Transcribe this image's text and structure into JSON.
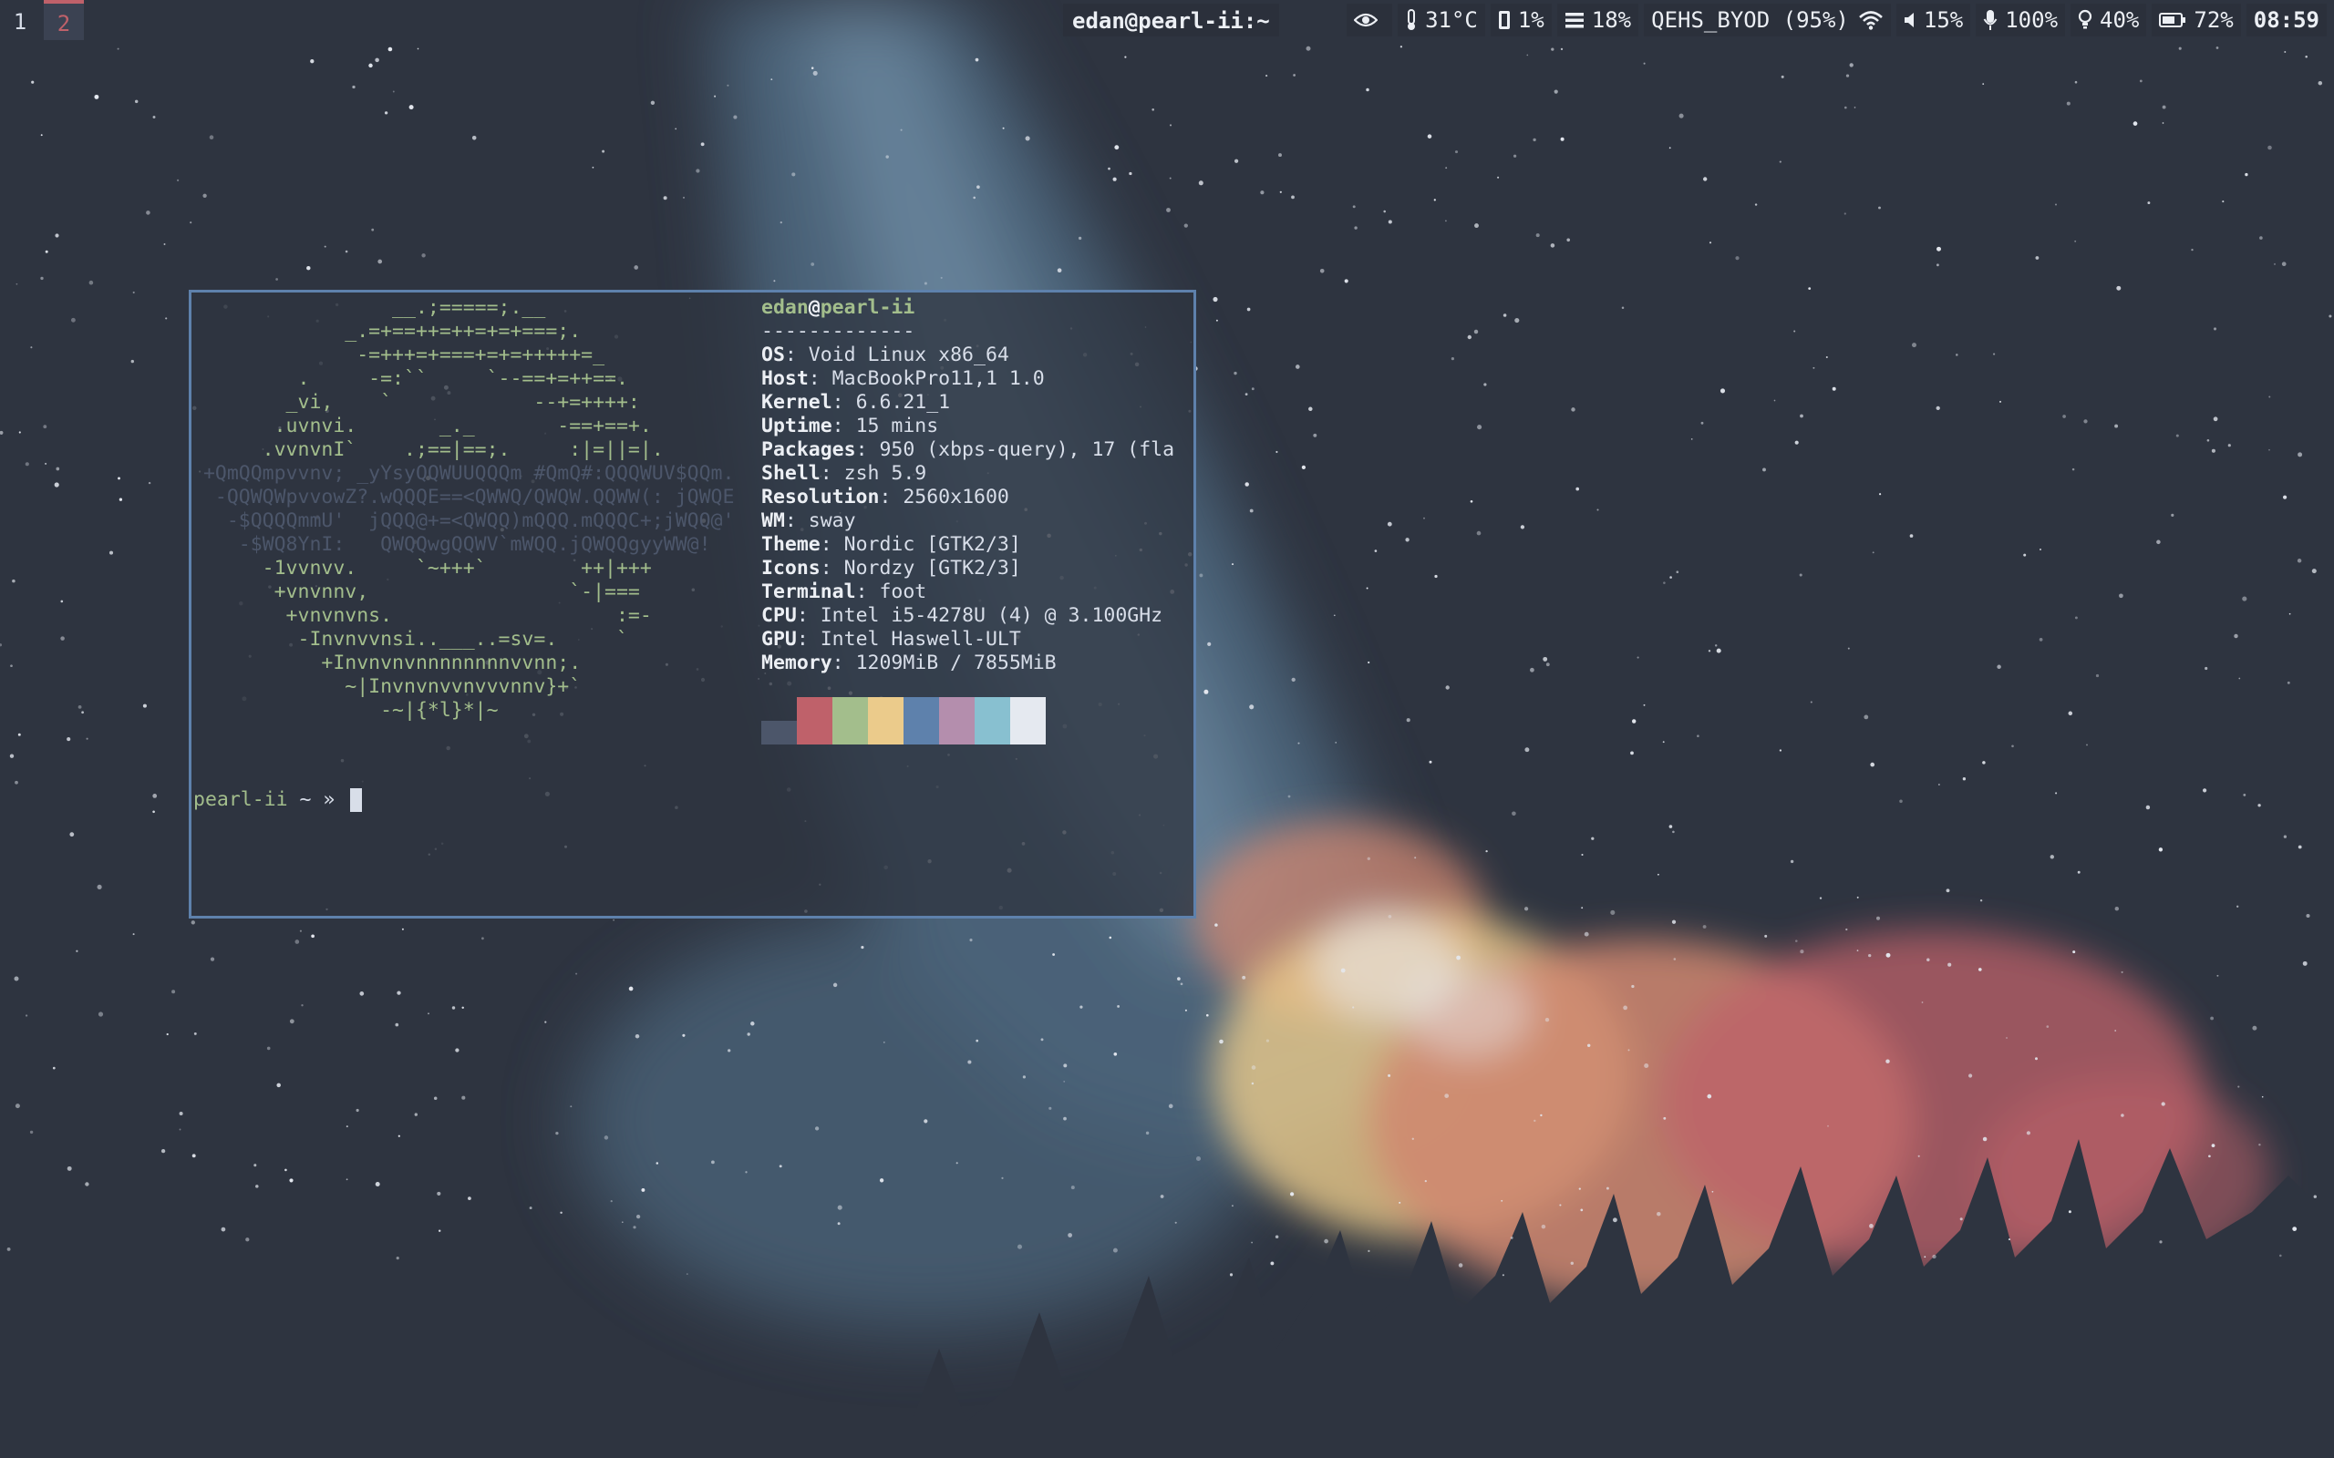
{
  "workspaces": [
    {
      "label": "1",
      "active": false
    },
    {
      "label": "2",
      "active": true
    }
  ],
  "window_title": "edan@pearl-ii:~",
  "status": {
    "temp": "31°C",
    "cpu": "1%",
    "mem": "18%",
    "wifi": "QEHS_BYOD (95%)",
    "volume": "15%",
    "mic": "100%",
    "brightness": "40%",
    "battery": "72%",
    "clock": "08:59"
  },
  "icons": [
    "eye-icon",
    "thermometer-icon",
    "cpu-icon",
    "memory-icon",
    "wifi-icon",
    "speaker-icon",
    "microphone-icon",
    "bulb-icon",
    "battery-icon"
  ],
  "colors": {
    "background": "#2e3440",
    "accent": "#5e81ac",
    "green": "#a3be8c",
    "red": "#bf616a",
    "text": "#eceff4"
  },
  "terminal": {
    "logo": [
      "                 __.;=====;.__",
      "             _.=+==++=++=+=+===;.",
      "              -=+++=+===+=+=+++++=_",
      "         .     -=:``     `--==+=++==.",
      "        _vi,    `            --+=++++:",
      "       .uvnvi.       _._       -==+==+.",
      "      .vvnvnI`    .;==|==;.     :|=||=|.",
      " +QmQQmpvvnv; _yYsyQQWUUQQQm #QmQ#:QQQWUV$QQm.",
      "  -QQWQWpvvowZ?.wQQQE==<QWWQ/QWQW.QQWW(: jQWQE",
      "   -$QQQQmmU'  jQQQ@+=<QWQQ)mQQQ.mQQQC+;jWQQ@'",
      "    -$WQ8YnI:   QWQQwgQQWV`mWQQ.jQWQQgyyWW@!",
      "      -1vvnvv.     `~+++`        ++|+++",
      "       +vnvnnv,                 `-|===",
      "        +vnvnvns.                   :=-",
      "         -Invnvvnsi..___..=sv=.     `",
      "           +Invnvnvnnnnnnnnvvnn;.",
      "             ~|Invnvnvvnvvvnnv}+`",
      "                -~|{*l}*|~"
    ],
    "user": "edan",
    "host": "pearl-ii",
    "separator": "-------------",
    "info": [
      {
        "key": "OS",
        "value": "Void Linux x86_64"
      },
      {
        "key": "Host",
        "value": "MacBookPro11,1 1.0"
      },
      {
        "key": "Kernel",
        "value": "6.6.21_1"
      },
      {
        "key": "Uptime",
        "value": "15 mins"
      },
      {
        "key": "Packages",
        "value": "950 (xbps-query), 17 (fla"
      },
      {
        "key": "Shell",
        "value": "zsh 5.9"
      },
      {
        "key": "Resolution",
        "value": "2560x1600"
      },
      {
        "key": "WM",
        "value": "sway"
      },
      {
        "key": "Theme",
        "value": "Nordic [GTK2/3]"
      },
      {
        "key": "Icons",
        "value": "Nordzy [GTK2/3]"
      },
      {
        "key": "Terminal",
        "value": "foot"
      },
      {
        "key": "CPU",
        "value": "Intel i5-4278U (4) @ 3.100GHz"
      },
      {
        "key": "GPU",
        "value": "Intel Haswell-ULT"
      },
      {
        "key": "Memory",
        "value": "1209MiB / 7855MiB"
      }
    ],
    "palette": [
      "#4c566a",
      "#bf616a",
      "#a3be8c",
      "#ebcb8b",
      "#5e81ac",
      "#b48ead",
      "#88c0d0",
      "#e5e9f0"
    ],
    "prompt": {
      "host": "pearl-ii",
      "rest": " ~ » "
    }
  }
}
